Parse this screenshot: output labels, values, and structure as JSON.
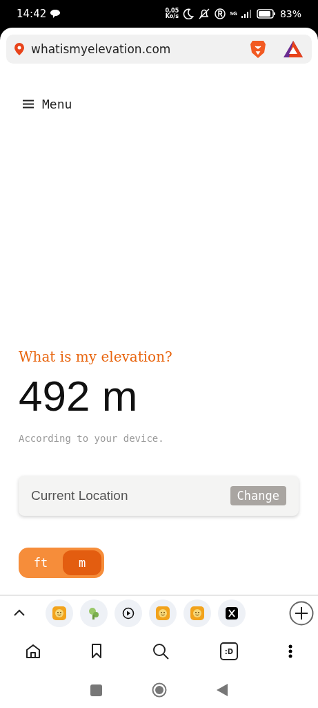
{
  "status_bar": {
    "time": "14:42",
    "speed_value": "0,05",
    "speed_unit": "Ko/s",
    "network": "5G",
    "battery": "83%"
  },
  "address_bar": {
    "url": "whatismyelevation.com"
  },
  "page": {
    "menu_label": "Menu",
    "heading": "What is my elevation?",
    "elevation": "492 m",
    "caption": "According to your device.",
    "location": {
      "label": "Current Location",
      "button": "Change"
    },
    "units": [
      {
        "label": "ft",
        "selected": false
      },
      {
        "label": "m",
        "selected": true
      }
    ]
  },
  "tab_strip": {
    "tabs": [
      {
        "kind": "smiley"
      },
      {
        "kind": "plant"
      },
      {
        "kind": "play"
      },
      {
        "kind": "smiley"
      },
      {
        "kind": "smiley"
      },
      {
        "kind": "cross"
      }
    ]
  },
  "bottom_nav": {
    "wallet_label": ":D"
  }
}
